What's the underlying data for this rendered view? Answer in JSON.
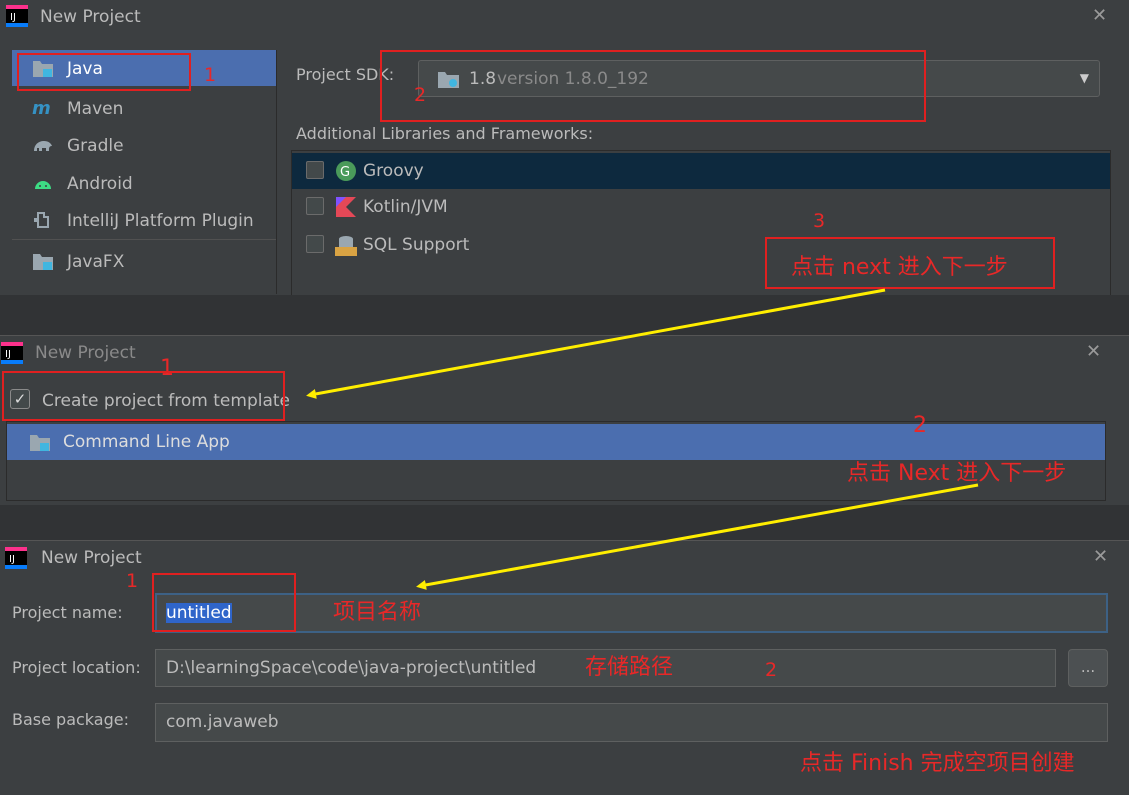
{
  "dialog1": {
    "title": "New Project",
    "sidebar": [
      {
        "label": "Java",
        "selected": true,
        "icon": "folder-icon"
      },
      {
        "label": "Maven",
        "icon": "maven-icon"
      },
      {
        "label": "Gradle",
        "icon": "gradle-icon"
      },
      {
        "label": "Android",
        "icon": "android-icon"
      },
      {
        "label": "IntelliJ Platform Plugin",
        "icon": "plugin-icon"
      },
      {
        "label": "JavaFX",
        "icon": "folder-icon"
      }
    ],
    "sdk_label": "Project SDK:",
    "sdk_version": "1.8",
    "sdk_detail": "version 1.8.0_192",
    "frameworks_label": "Additional Libraries and Frameworks:",
    "frameworks": [
      {
        "label": "Groovy",
        "checked": false,
        "selected": true,
        "icon": "groovy-icon"
      },
      {
        "label": "Kotlin/JVM",
        "checked": false,
        "icon": "kotlin-icon"
      },
      {
        "label": "SQL Support",
        "checked": false,
        "icon": "sql-icon"
      }
    ]
  },
  "dialog2": {
    "title": "New Project",
    "template_checkbox_label": "Create project from template",
    "template_checked": true,
    "templates": [
      {
        "label": "Command Line App",
        "selected": true
      }
    ]
  },
  "dialog3": {
    "title": "New Project",
    "name_label": "Project name:",
    "name_value": "untitled",
    "location_label": "Project location:",
    "location_value": "D:\\learningSpace\\code\\java-project\\untitled",
    "browse_label": "...",
    "package_label": "Base package:",
    "package_value": "com.javaweb"
  },
  "annotations": {
    "a1": "1",
    "a2": "2",
    "a3": "3",
    "a3_text": "点击  next 进入下一步",
    "b1": "1",
    "b2": "2",
    "b2_text": "点击 Next 进入下一步",
    "c1": "1",
    "c1_text": "项目名称",
    "c2": "2",
    "c2_text": "存储路径",
    "c3_text": "点击 Finish 完成空项目创建"
  },
  "colors": {
    "background": "#3c3f41",
    "selection": "#4b6eaf",
    "annotation_red": "#e02020",
    "arrow_yellow": "#ffee00"
  }
}
